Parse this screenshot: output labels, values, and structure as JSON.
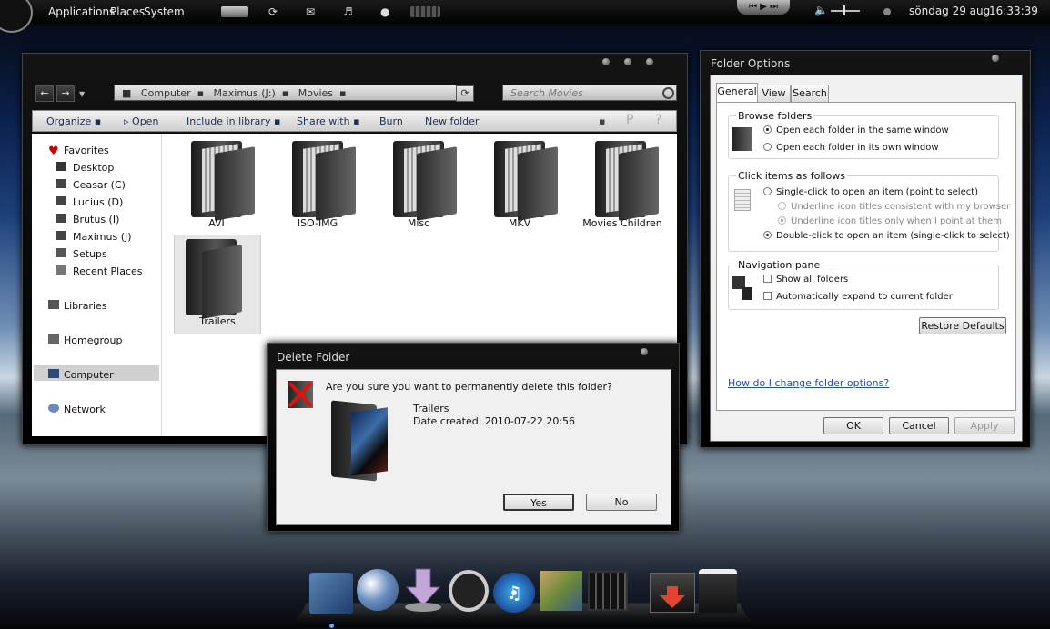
{
  "topbar": {
    "menus": [
      "Applications",
      "Places",
      "System"
    ],
    "date": "söndag 29 aug",
    "time": "16:33:39"
  },
  "explorer": {
    "breadcrumb": [
      "Computer",
      "Maximus (J:)",
      "Movies"
    ],
    "search_placeholder": "Search Movies",
    "toolbar": {
      "organize": "Organize",
      "open": "Open",
      "include": "Include in library",
      "share": "Share with",
      "burn": "Burn",
      "new_folder": "New folder"
    },
    "nav": {
      "favorites": "Favorites",
      "desktop": "Desktop",
      "drives": [
        "Ceasar (C)",
        "Lucius (D)",
        "Brutus (I)",
        "Maximus (J)"
      ],
      "setups": "Setups",
      "recent": "Recent Places",
      "libraries": "Libraries",
      "homegroup": "Homegroup",
      "computer": "Computer",
      "network": "Network"
    },
    "folders": [
      "AVI",
      "ISO-IMG",
      "Misc",
      "MKV",
      "Movies Children",
      "Trailers"
    ]
  },
  "folder_options": {
    "title": "Folder Options",
    "tabs": [
      "General",
      "View",
      "Search"
    ],
    "browse": {
      "title": "Browse folders",
      "same": "Open each folder in the same window",
      "own": "Open each folder in its own window"
    },
    "click": {
      "title": "Click items as follows",
      "single": "Single-click to open an item (point to select)",
      "underline_consistent": "Underline icon titles consistent with my browser",
      "underline_point": "Underline icon titles only when I point at them",
      "double": "Double-click to open an item (single-click to select)"
    },
    "navpane": {
      "title": "Navigation pane",
      "show_all": "Show all folders",
      "expand": "Automatically expand to current folder"
    },
    "restore": "Restore Defaults",
    "help_link": "How do I change folder options?",
    "ok": "OK",
    "cancel": "Cancel",
    "apply": "Apply"
  },
  "delete_dialog": {
    "title": "Delete Folder",
    "question": "Are you sure you want to permanently delete this folder?",
    "name": "Trailers",
    "date": "Date created: 2010-07-22 20:56",
    "yes": "Yes",
    "no": "No"
  }
}
